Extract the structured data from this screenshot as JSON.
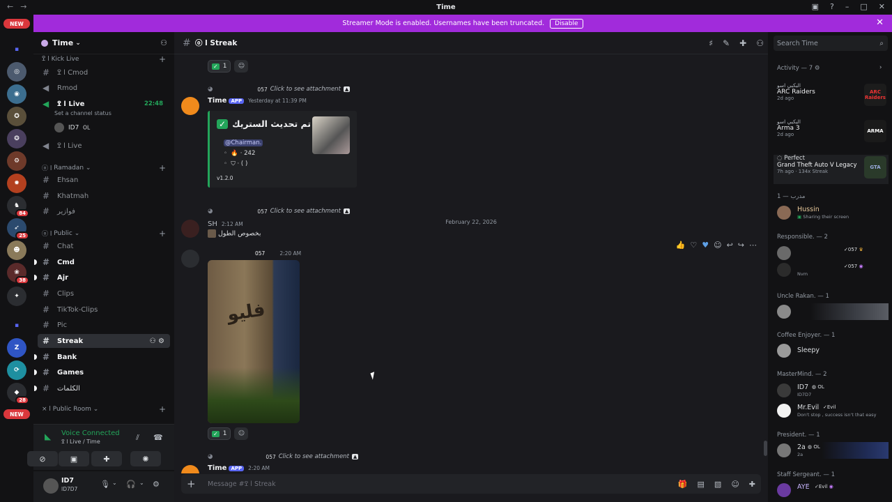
{
  "window": {
    "title": "Time"
  },
  "banner": {
    "text": "Streamer Mode is enabled. Usernames have been truncated.",
    "disable_label": "Disable"
  },
  "servers": {
    "new_label_top": "NEW",
    "new_label_bottom": "NEW",
    "badges": [
      "84",
      "25",
      "38",
      "28"
    ]
  },
  "guild": {
    "name": "Time"
  },
  "categories": {
    "kick_live": "Kick Live",
    "ramadan": "Ramadan",
    "public": "Public",
    "public_room": "Public Room"
  },
  "channels": [
    {
      "name": "ߐ l Cmod"
    },
    {
      "name": "Rmod"
    },
    {
      "name": "ߐ l Live",
      "time": "22:48"
    },
    {
      "name": "ߐ l Live"
    },
    {
      "name": "Ehsan"
    },
    {
      "name": "Khatmah"
    },
    {
      "name": "فوازير"
    },
    {
      "name": "Chat"
    },
    {
      "name": "Cmd"
    },
    {
      "name": "Ajr"
    },
    {
      "name": "Clips"
    },
    {
      "name": "TikTok-Clips"
    },
    {
      "name": "Pic"
    },
    {
      "name": "Streak"
    },
    {
      "name": "Bank"
    },
    {
      "name": "Games"
    },
    {
      "name": "الكلمات"
    }
  ],
  "channel_status": "Set a channel status",
  "voice_user": {
    "name": "ID7",
    "tag": "OL"
  },
  "voice": {
    "title": "Voice Connected",
    "subtitle": "ߐ l Live / Time"
  },
  "user": {
    "name": "ID7",
    "status": "ID7D7"
  },
  "header": {
    "channel": "Streak"
  },
  "search": {
    "placeholder": "Search Time"
  },
  "messages": {
    "reaction_count_1": "1",
    "reply1": {
      "tag": "057",
      "text": "Click to see attachment"
    },
    "msg1": {
      "author": "Time",
      "app": "APP",
      "time": "Yesterday at 11:39 PM"
    },
    "embed": {
      "title": "تم تحديث الستريك •",
      "mention": "@Chairman.",
      "line1": "242",
      "line2": "( )",
      "footer": "v1.2.0"
    },
    "date_divider": "February 22, 2026",
    "reply2": {
      "tag": "057",
      "text": "Click to see attachment"
    },
    "msg2": {
      "author": "SH",
      "time": "2:12 AM",
      "text": "بخصوص الطول"
    },
    "msg3": {
      "tag": "057",
      "time": "2:20 AM"
    },
    "photo_text": "فليو",
    "reaction_count_2": "1",
    "reply3": {
      "tag": "057",
      "text": "Click to see attachment"
    },
    "msg4": {
      "author": "Time",
      "app": "APP",
      "time": "2:20 AM"
    }
  },
  "composer": {
    "placeholder": "Message #ߐ l Streak"
  },
  "activity": {
    "header": "Activity — 7",
    "items": [
      {
        "label": "البكبي اسو",
        "game": "ARC Raiders",
        "ago": "2d ago",
        "img": "ARC Raiders"
      },
      {
        "label": "البكبي اسو",
        "game": "Arma 3",
        "ago": "2d ago",
        "img": "ARMA"
      },
      {
        "label": "Perfect",
        "game": "Grand Theft Auto V Legacy",
        "ago": "7h ago · 134x Streak",
        "img": "GTA"
      }
    ]
  },
  "members": {
    "group1": "مدرب — 1",
    "m1": {
      "name": "Hussin",
      "status": "Sharing their screen"
    },
    "group2": "Responsible. — 2",
    "m2": {
      "tag": "057"
    },
    "m3": {
      "tag": "057",
      "status": "Nvm"
    },
    "group3": "Uncle Rakan. — 1",
    "group4": "Coffee Enjoyer. — 1",
    "m4": {
      "name": "Sleepy"
    },
    "group5": "MasterMind. — 2",
    "m5": {
      "name": "ID7",
      "tag": "OL",
      "status": "ID7D7"
    },
    "m6": {
      "name": "Mr.Evil",
      "tag": "Evil",
      "status": "Don't stop , success isn't that easy"
    },
    "group6": "President. — 1",
    "m7": {
      "name": "2a",
      "tag": "OL",
      "status": "2a"
    },
    "group7": "Staff Sergeant. — 1",
    "m8": {
      "name": "AYE",
      "tag": "Evil"
    }
  }
}
